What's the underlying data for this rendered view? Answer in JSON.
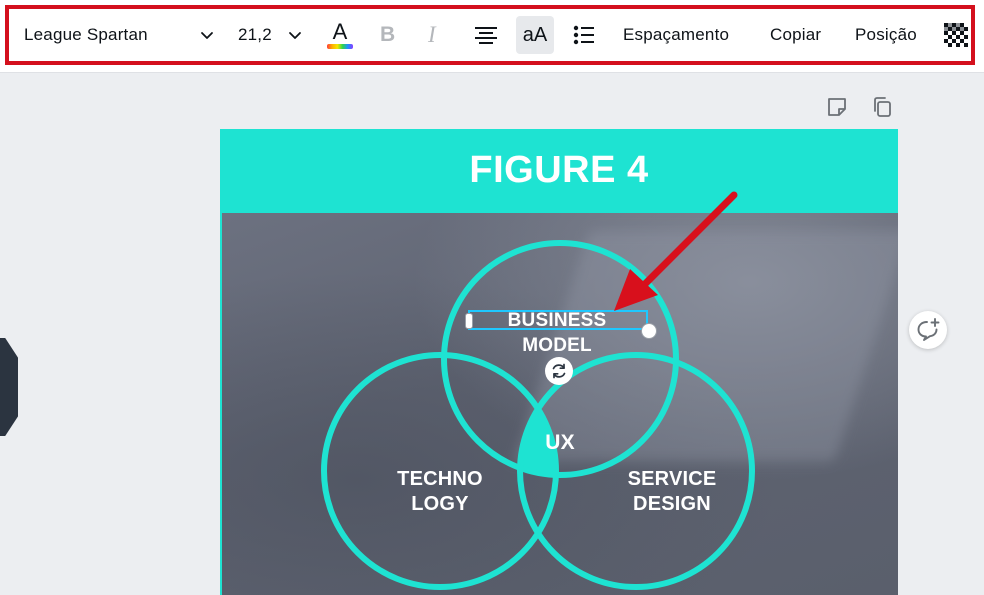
{
  "toolbar": {
    "font_family": "League Spartan",
    "font_size": "21,2",
    "text_color_letter": "A",
    "bold_label": "B",
    "italic_label": "I",
    "case_label": "aA",
    "spacing_label": "Espaçamento",
    "copy_label": "Copiar",
    "position_label": "Posição",
    "icons": [
      "chevron-down-icon",
      "text-color-icon",
      "bold-icon",
      "italic-icon",
      "align-center-icon",
      "text-case-icon",
      "list-icon",
      "transparency-icon"
    ]
  },
  "canvas": {
    "icons": [
      "notes-icon",
      "duplicate-icon",
      "comment-add-icon",
      "rotate-icon"
    ]
  },
  "design": {
    "title": "FIGURE 4",
    "labels": {
      "business": "BUSINESS MODEL",
      "ux": "UX",
      "technology": "TECHNO\nLOGY",
      "service": "SERVICE\nDESIGN"
    }
  },
  "colors": {
    "accent_teal": "#1ee3d2",
    "highlight_red": "#d4101d",
    "arrow_red": "#d8101c",
    "selection_blue": "#1ec8ff",
    "photo_gray": "#5f6472"
  }
}
